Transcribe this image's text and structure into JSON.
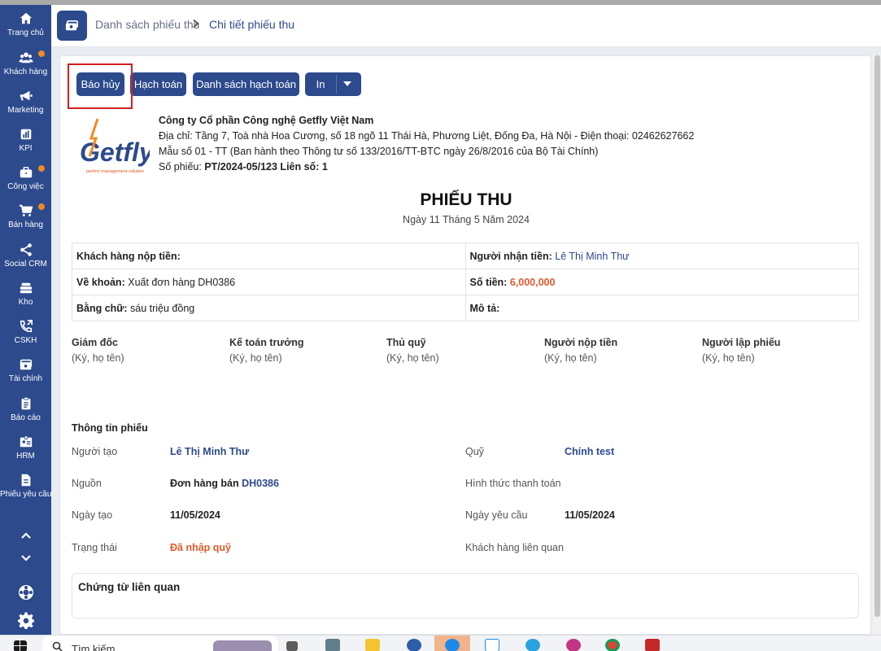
{
  "sidebar": {
    "items": [
      {
        "label": "Trang chủ",
        "icon": "home-icon"
      },
      {
        "label": "Khách hàng",
        "icon": "users-icon",
        "dot": true
      },
      {
        "label": "Marketing",
        "icon": "megaphone-icon"
      },
      {
        "label": "KPI",
        "icon": "chart-icon"
      },
      {
        "label": "Công việc",
        "icon": "briefcase-icon",
        "dot": true
      },
      {
        "label": "Bán hàng",
        "icon": "cart-icon",
        "dot": true
      },
      {
        "label": "Social CRM",
        "icon": "share-icon"
      },
      {
        "label": "Kho",
        "icon": "warehouse-icon"
      },
      {
        "label": "CSKH",
        "icon": "phone-icon"
      },
      {
        "label": "Tài chính",
        "icon": "money-icon"
      },
      {
        "label": "Báo cáo",
        "icon": "clipboard-icon"
      },
      {
        "label": "HRM",
        "icon": "id-card-icon"
      },
      {
        "label": "Phiếu yêu cầu",
        "icon": "document-icon"
      }
    ],
    "accent_dot_color": "#f08a24"
  },
  "breadcrumb": {
    "parent": "Danh sách phiếu thu",
    "current": "Chi tiết phiếu thu"
  },
  "toolbar": {
    "cancel_report": "Báo hủy",
    "accounting": "Hạch toán",
    "accounting_list": "Danh sách hạch toán",
    "print": "In"
  },
  "company": {
    "name": "Công ty Cổ phần Công nghệ Getfly Việt Nam",
    "address": "Địa chỉ: Tầng 7, Toà nhà Hoa Cương, số 18 ngõ 11 Thái Hà, Phương Liệt, Đống Đa, Hà Nội - Điện thoại: 02462627662",
    "form": "Mẫu số 01 - TT (Ban hành theo Thông tư số 133/2016/TT-BTC ngày 26/8/2016 của Bộ Tài Chính)",
    "receipt_no_label": "Số phiếu:",
    "receipt_no_value": "PT/2024-05/123 Liên số: 1"
  },
  "logo": {
    "text": "Getfly",
    "tagline": "perfect management solution"
  },
  "receipt": {
    "title": "PHIẾU THU",
    "date": "Ngày 11 Tháng 5 Năm 2024"
  },
  "info": {
    "payer_label": "Khách hàng nộp tiền:",
    "receiver_label": "Người nhận tiền:",
    "receiver_value": "Lê Thị Minh Thư",
    "reason_label": "Về khoản:",
    "reason_value": "Xuất đơn hàng DH0386",
    "amount_label": "Số tiền:",
    "amount_value": "6,000,000",
    "words_label": "Bằng chữ:",
    "words_value": "sáu triệu đồng",
    "desc_label": "Mô tả:"
  },
  "signatures": [
    {
      "title": "Giám đốc",
      "sub": "(Ký, họ tên)"
    },
    {
      "title": "Kế toán trưởng",
      "sub": "(Ký, họ tên)"
    },
    {
      "title": "Thủ quỹ",
      "sub": "(Ký, họ tên)"
    },
    {
      "title": "Người nộp tiền",
      "sub": "(Ký, họ tên)"
    },
    {
      "title": "Người lập phiếu",
      "sub": "(Ký, họ tên)"
    }
  ],
  "ticket": {
    "section_title": "Thông tin phiếu",
    "creator_label": "Người tạo",
    "creator_value": "Lê Thị Minh Thư",
    "fund_label": "Quỹ",
    "fund_value": "Chính test",
    "source_label": "Nguồn",
    "source_value": "Đơn hàng bán",
    "source_code": "DH0386",
    "payment_label": "Hình thức thanh toán",
    "created_label": "Ngày tạo",
    "created_value": "11/05/2024",
    "request_label": "Ngày yêu cầu",
    "request_value": "11/05/2024",
    "status_label": "Trạng thái",
    "status_value": "Đã nhập quỹ",
    "related_customer_label": "Khách hàng liên quan"
  },
  "related_docs": {
    "title": "Chứng từ liên quan"
  },
  "taskbar": {
    "search_label": "Tìm kiếm",
    "apps": [
      "start-icon",
      "search-icon",
      "task-view-icon",
      "calculator-icon",
      "folder-icon",
      "mail-icon",
      "skype-icon",
      "zalo-icon",
      "telegram-icon",
      "messenger-icon",
      "chrome-icon",
      "app-icon"
    ]
  },
  "colors": {
    "primary": "#2c4a8c",
    "accent": "#e05a2b",
    "highlight_border": "#d32020"
  }
}
